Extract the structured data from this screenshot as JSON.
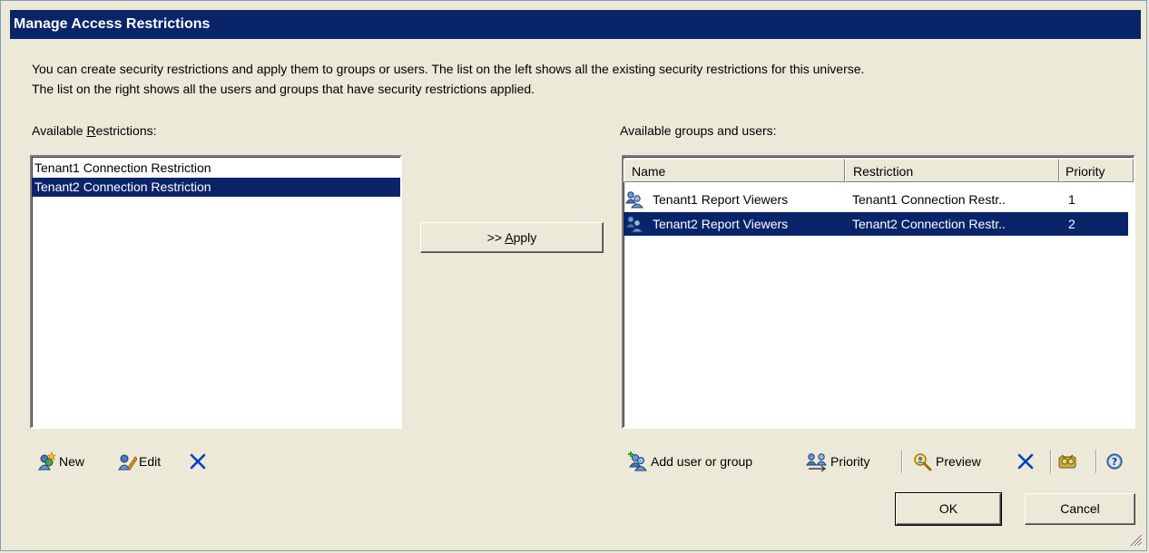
{
  "dialog": {
    "title": "Manage Access Restrictions",
    "description_line1": "You can create security restrictions and apply them to groups or users. The list on the left shows all the existing security restrictions for this universe.",
    "description_line2": "The list on the right shows all the users and groups that have security restrictions applied."
  },
  "restrictions": {
    "label_pre": "Available ",
    "label_u": "R",
    "label_post": "estrictions:",
    "items": [
      {
        "label": "Tenant1 Connection Restriction",
        "selected": false
      },
      {
        "label": "Tenant2 Connection Restriction",
        "selected": true
      }
    ],
    "toolbar": {
      "new_label": "New",
      "edit_label": "Edit"
    }
  },
  "apply": {
    "prefix": ">> ",
    "u": "A",
    "rest": "pply"
  },
  "groups": {
    "label_pre": "Available ",
    "label_u": "g",
    "label_post": "roups and users:",
    "columns": {
      "name": "Name",
      "restriction": "Restriction",
      "priority": "Priority"
    },
    "rows": [
      {
        "name": "Tenant1 Report Viewers",
        "restriction": "Tenant1 Connection Restr..",
        "priority": "1",
        "selected": false
      },
      {
        "name": "Tenant2 Report Viewers",
        "restriction": "Tenant2 Connection Restr..",
        "priority": "2",
        "selected": true
      }
    ],
    "toolbar": {
      "add_label": "Add user or group",
      "priority_label": "Priority",
      "preview_label": "Preview"
    }
  },
  "buttons": {
    "ok": "OK",
    "cancel": "Cancel"
  },
  "colors": {
    "selection": "#0a246a",
    "face": "#ece9d8",
    "delete_x": "#0040c0"
  }
}
